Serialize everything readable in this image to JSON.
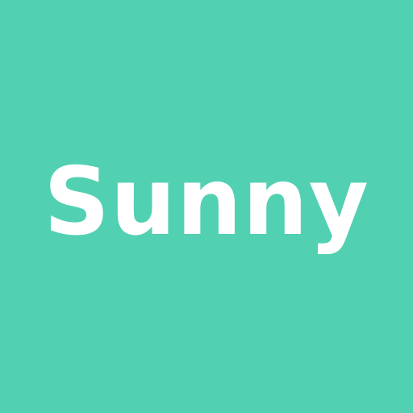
{
  "logo": {
    "text": "Sunny",
    "background_color": "#52d0b2",
    "text_color": "#ffffff"
  }
}
